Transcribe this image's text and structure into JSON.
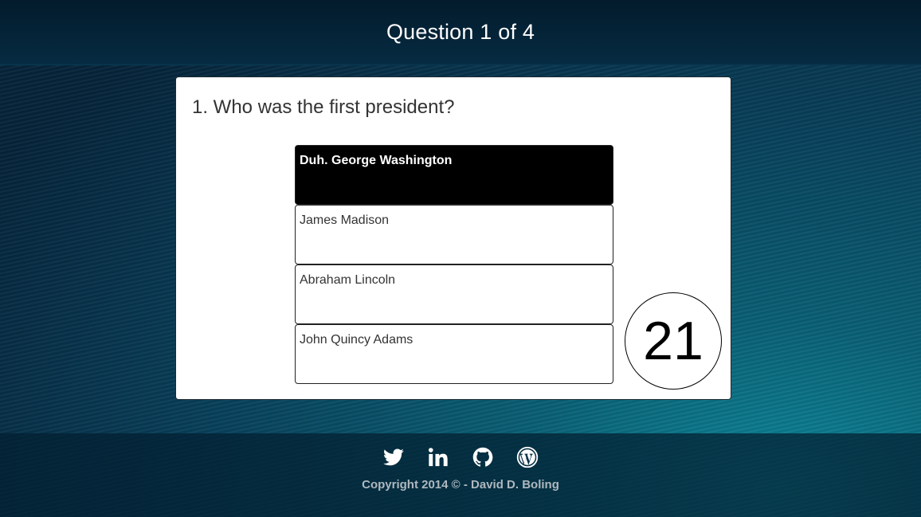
{
  "header": {
    "title": "Question 1 of 4"
  },
  "question": {
    "text": "1. Who was the first president?",
    "answers": [
      {
        "label": "Duh. George Washington",
        "selected": true
      },
      {
        "label": "James Madison",
        "selected": false
      },
      {
        "label": "Abraham Lincoln",
        "selected": false
      },
      {
        "label": "John Quincy Adams",
        "selected": false
      }
    ],
    "timer": "21"
  },
  "footer": {
    "social_icons": [
      "twitter-icon",
      "linkedin-icon",
      "github-icon",
      "wordpress-icon"
    ],
    "copyright": "Copyright 2014 © - David D. Boling"
  },
  "colors": {
    "selected_answer_bg": "#000000",
    "footer_text": "#aeb8bf"
  }
}
